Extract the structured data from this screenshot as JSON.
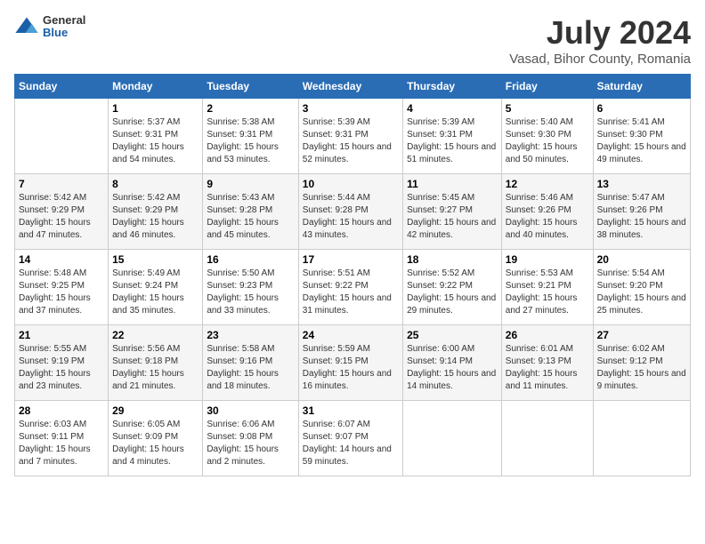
{
  "header": {
    "logo": {
      "general": "General",
      "blue": "Blue"
    },
    "title": "July 2024",
    "location": "Vasad, Bihor County, Romania"
  },
  "weekdays": [
    "Sunday",
    "Monday",
    "Tuesday",
    "Wednesday",
    "Thursday",
    "Friday",
    "Saturday"
  ],
  "weeks": [
    [
      null,
      {
        "day": 1,
        "sunrise": "5:37 AM",
        "sunset": "9:31 PM",
        "daylight": "15 hours and 54 minutes."
      },
      {
        "day": 2,
        "sunrise": "5:38 AM",
        "sunset": "9:31 PM",
        "daylight": "15 hours and 53 minutes."
      },
      {
        "day": 3,
        "sunrise": "5:39 AM",
        "sunset": "9:31 PM",
        "daylight": "15 hours and 52 minutes."
      },
      {
        "day": 4,
        "sunrise": "5:39 AM",
        "sunset": "9:31 PM",
        "daylight": "15 hours and 51 minutes."
      },
      {
        "day": 5,
        "sunrise": "5:40 AM",
        "sunset": "9:30 PM",
        "daylight": "15 hours and 50 minutes."
      },
      {
        "day": 6,
        "sunrise": "5:41 AM",
        "sunset": "9:30 PM",
        "daylight": "15 hours and 49 minutes."
      }
    ],
    [
      {
        "day": 7,
        "sunrise": "5:42 AM",
        "sunset": "9:29 PM",
        "daylight": "15 hours and 47 minutes."
      },
      {
        "day": 8,
        "sunrise": "5:42 AM",
        "sunset": "9:29 PM",
        "daylight": "15 hours and 46 minutes."
      },
      {
        "day": 9,
        "sunrise": "5:43 AM",
        "sunset": "9:28 PM",
        "daylight": "15 hours and 45 minutes."
      },
      {
        "day": 10,
        "sunrise": "5:44 AM",
        "sunset": "9:28 PM",
        "daylight": "15 hours and 43 minutes."
      },
      {
        "day": 11,
        "sunrise": "5:45 AM",
        "sunset": "9:27 PM",
        "daylight": "15 hours and 42 minutes."
      },
      {
        "day": 12,
        "sunrise": "5:46 AM",
        "sunset": "9:26 PM",
        "daylight": "15 hours and 40 minutes."
      },
      {
        "day": 13,
        "sunrise": "5:47 AM",
        "sunset": "9:26 PM",
        "daylight": "15 hours and 38 minutes."
      }
    ],
    [
      {
        "day": 14,
        "sunrise": "5:48 AM",
        "sunset": "9:25 PM",
        "daylight": "15 hours and 37 minutes."
      },
      {
        "day": 15,
        "sunrise": "5:49 AM",
        "sunset": "9:24 PM",
        "daylight": "15 hours and 35 minutes."
      },
      {
        "day": 16,
        "sunrise": "5:50 AM",
        "sunset": "9:23 PM",
        "daylight": "15 hours and 33 minutes."
      },
      {
        "day": 17,
        "sunrise": "5:51 AM",
        "sunset": "9:22 PM",
        "daylight": "15 hours and 31 minutes."
      },
      {
        "day": 18,
        "sunrise": "5:52 AM",
        "sunset": "9:22 PM",
        "daylight": "15 hours and 29 minutes."
      },
      {
        "day": 19,
        "sunrise": "5:53 AM",
        "sunset": "9:21 PM",
        "daylight": "15 hours and 27 minutes."
      },
      {
        "day": 20,
        "sunrise": "5:54 AM",
        "sunset": "9:20 PM",
        "daylight": "15 hours and 25 minutes."
      }
    ],
    [
      {
        "day": 21,
        "sunrise": "5:55 AM",
        "sunset": "9:19 PM",
        "daylight": "15 hours and 23 minutes."
      },
      {
        "day": 22,
        "sunrise": "5:56 AM",
        "sunset": "9:18 PM",
        "daylight": "15 hours and 21 minutes."
      },
      {
        "day": 23,
        "sunrise": "5:58 AM",
        "sunset": "9:16 PM",
        "daylight": "15 hours and 18 minutes."
      },
      {
        "day": 24,
        "sunrise": "5:59 AM",
        "sunset": "9:15 PM",
        "daylight": "15 hours and 16 minutes."
      },
      {
        "day": 25,
        "sunrise": "6:00 AM",
        "sunset": "9:14 PM",
        "daylight": "15 hours and 14 minutes."
      },
      {
        "day": 26,
        "sunrise": "6:01 AM",
        "sunset": "9:13 PM",
        "daylight": "15 hours and 11 minutes."
      },
      {
        "day": 27,
        "sunrise": "6:02 AM",
        "sunset": "9:12 PM",
        "daylight": "15 hours and 9 minutes."
      }
    ],
    [
      {
        "day": 28,
        "sunrise": "6:03 AM",
        "sunset": "9:11 PM",
        "daylight": "15 hours and 7 minutes."
      },
      {
        "day": 29,
        "sunrise": "6:05 AM",
        "sunset": "9:09 PM",
        "daylight": "15 hours and 4 minutes."
      },
      {
        "day": 30,
        "sunrise": "6:06 AM",
        "sunset": "9:08 PM",
        "daylight": "15 hours and 2 minutes."
      },
      {
        "day": 31,
        "sunrise": "6:07 AM",
        "sunset": "9:07 PM",
        "daylight": "14 hours and 59 minutes."
      },
      null,
      null,
      null
    ]
  ]
}
